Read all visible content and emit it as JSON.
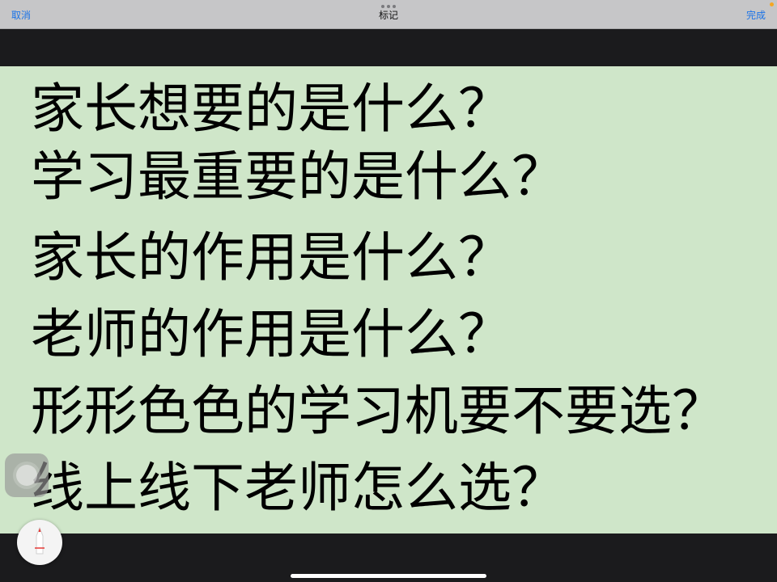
{
  "toolbar": {
    "cancel_label": "取消",
    "title": "标记",
    "done_label": "完成"
  },
  "slide": {
    "lines": [
      "家长想要的是什么？",
      "学习最重要的是什么？",
      "家长的作用是什么？",
      "老师的作用是什么？",
      "形形色色的学习机要不要选？",
      "线上线下老师怎么选？"
    ]
  },
  "colors": {
    "accent": "#1a73e8",
    "slide_background": "#cfe6c9",
    "toolbar_background": "#c6c6c8",
    "pen_tip": "#e53935"
  },
  "icons": {
    "assistive_touch": "assistive-touch-icon",
    "pen": "pen-icon"
  }
}
